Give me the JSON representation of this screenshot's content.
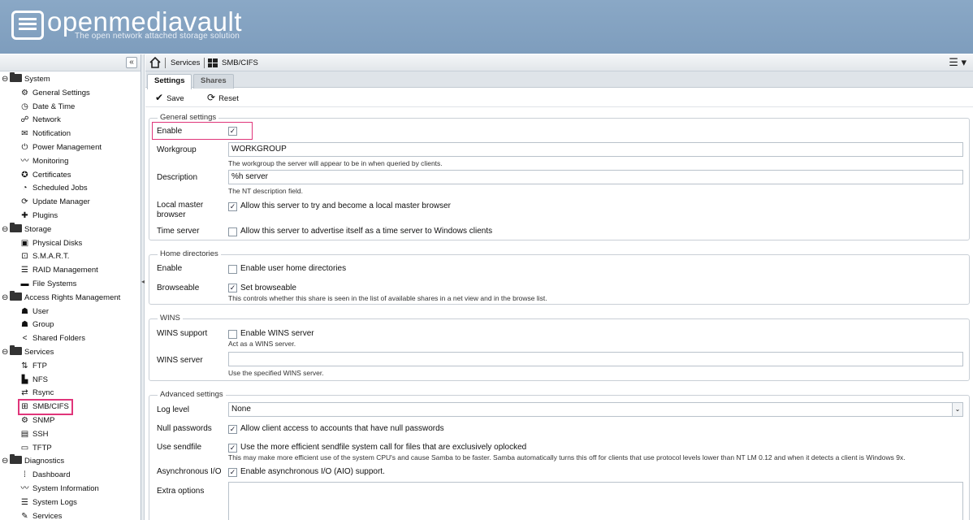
{
  "header": {
    "logo_text": "openmediavault",
    "tagline": "The open network attached storage solution"
  },
  "sidebar": {
    "collapse_glyph": "«",
    "items": [
      {
        "type": "cat",
        "label": "System"
      },
      {
        "type": "item",
        "label": "General Settings",
        "icon": "gears-icon",
        "glyph": "⚙"
      },
      {
        "type": "item",
        "label": "Date & Time",
        "icon": "clock-icon",
        "glyph": "◷"
      },
      {
        "type": "item",
        "label": "Network",
        "icon": "network-icon",
        "glyph": "☍"
      },
      {
        "type": "item",
        "label": "Notification",
        "icon": "envelope-icon",
        "glyph": "✉"
      },
      {
        "type": "item",
        "label": "Power Management",
        "icon": "power-icon",
        "glyph": "⏻"
      },
      {
        "type": "item",
        "label": "Monitoring",
        "icon": "chart-icon",
        "glyph": "〰"
      },
      {
        "type": "item",
        "label": "Certificates",
        "icon": "certificate-icon",
        "glyph": "✪"
      },
      {
        "type": "item",
        "label": "Scheduled Jobs",
        "icon": "scheduled-clock-icon",
        "glyph": "◔"
      },
      {
        "type": "item",
        "label": "Update Manager",
        "icon": "update-icon",
        "glyph": "⟳"
      },
      {
        "type": "item",
        "label": "Plugins",
        "icon": "puzzle-icon",
        "glyph": "✚"
      },
      {
        "type": "cat",
        "label": "Storage"
      },
      {
        "type": "item",
        "label": "Physical Disks",
        "icon": "disk-icon",
        "glyph": "▣"
      },
      {
        "type": "item",
        "label": "S.M.A.R.T.",
        "icon": "smart-icon",
        "glyph": "⊡"
      },
      {
        "type": "item",
        "label": "RAID Management",
        "icon": "raid-icon",
        "glyph": "☰"
      },
      {
        "type": "item",
        "label": "File Systems",
        "icon": "folder-icon",
        "glyph": "▬"
      },
      {
        "type": "cat",
        "label": "Access Rights Management"
      },
      {
        "type": "item",
        "label": "User",
        "icon": "user-icon",
        "glyph": "☗"
      },
      {
        "type": "item",
        "label": "Group",
        "icon": "group-icon",
        "glyph": "☗"
      },
      {
        "type": "item",
        "label": "Shared Folders",
        "icon": "share-icon",
        "glyph": "<"
      },
      {
        "type": "cat",
        "label": "Services"
      },
      {
        "type": "item",
        "label": "FTP",
        "icon": "ftp-icon",
        "glyph": "⇅"
      },
      {
        "type": "item",
        "label": "NFS",
        "icon": "nfs-icon",
        "glyph": "▙"
      },
      {
        "type": "item",
        "label": "Rsync",
        "icon": "rsync-icon",
        "glyph": "⇄"
      },
      {
        "type": "item",
        "label": "SMB/CIFS",
        "icon": "windows-icon",
        "glyph": "⊞",
        "selected": true
      },
      {
        "type": "item",
        "label": "SNMP",
        "icon": "snmp-icon",
        "glyph": "⚙"
      },
      {
        "type": "item",
        "label": "SSH",
        "icon": "terminal-icon",
        "glyph": "▤"
      },
      {
        "type": "item",
        "label": "TFTP",
        "icon": "tftp-icon",
        "glyph": "▭"
      },
      {
        "type": "cat",
        "label": "Diagnostics"
      },
      {
        "type": "item",
        "label": "Dashboard",
        "icon": "dashboard-icon",
        "glyph": "⁞"
      },
      {
        "type": "item",
        "label": "System Information",
        "icon": "info-chart-icon",
        "glyph": "〰"
      },
      {
        "type": "item",
        "label": "System Logs",
        "icon": "logs-icon",
        "glyph": "☰"
      },
      {
        "type": "item",
        "label": "Services",
        "icon": "wrench-icon",
        "glyph": "✎"
      }
    ]
  },
  "breadcrumb": {
    "services": "Services",
    "current": "SMB/CIFS"
  },
  "tabs": {
    "settings": "Settings",
    "shares": "Shares"
  },
  "toolbar": {
    "save": "Save",
    "reset": "Reset"
  },
  "general": {
    "legend": "General settings",
    "enable_label": "Enable",
    "workgroup_label": "Workgroup",
    "workgroup_value": "WORKGROUP",
    "workgroup_help": "The workgroup the server will appear to be in when queried by clients.",
    "description_label": "Description",
    "description_value": "%h server",
    "description_help": "The NT description field.",
    "local_master_label": "Local master browser",
    "local_master_text": "Allow this server to try and become a local master browser",
    "time_server_label": "Time server",
    "time_server_text": "Allow this server to advertise itself as a time server to Windows clients"
  },
  "home": {
    "legend": "Home directories",
    "enable_label": "Enable",
    "enable_text": "Enable user home directories",
    "browseable_label": "Browseable",
    "browseable_text": "Set browseable",
    "browseable_help": "This controls whether this share is seen in the list of available shares in a net view and in the browse list."
  },
  "wins": {
    "legend": "WINS",
    "support_label": "WINS support",
    "support_text": "Enable WINS server",
    "support_help": "Act as a WINS server.",
    "server_label": "WINS server",
    "server_value": "",
    "server_help": "Use the specified WINS server."
  },
  "advanced": {
    "legend": "Advanced settings",
    "log_level_label": "Log level",
    "log_level_value": "None",
    "null_pw_label": "Null passwords",
    "null_pw_text": "Allow client access to accounts that have null passwords",
    "sendfile_label": "Use sendfile",
    "sendfile_text": "Use the more efficient sendfile system call for files that are exclusively oplocked",
    "sendfile_help": "This may make more efficient use of the system CPU's and cause Samba to be faster. Samba automatically turns this off for clients that use protocol levels lower than NT LM 0.12 and when it detects a client is Windows 9x.",
    "aio_label": "Asynchronous I/O",
    "aio_text": "Enable asynchronous I/O (AIO) support.",
    "extra_label": "Extra options"
  },
  "checkbox_states": {
    "enable": true,
    "local_master": true,
    "time_server": false,
    "home_enable": false,
    "browseable": true,
    "wins_support": false,
    "null_passwords": true,
    "sendfile": true,
    "aio": true
  },
  "colors": {
    "header": "#8aa8c6",
    "highlight": "#e0357a"
  }
}
